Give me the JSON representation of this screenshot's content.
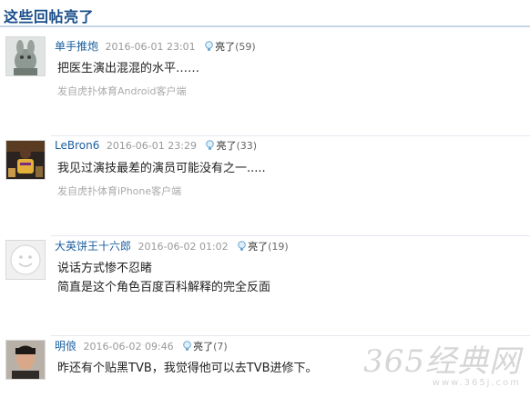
{
  "section_title": "这些回帖亮了",
  "light_label": "亮了",
  "posts": [
    {
      "username": "单手推炮",
      "time": "2016-06-01 23:01",
      "light_count": "(59)",
      "content": [
        "把医生演出混混的水平……"
      ],
      "source": "发自虎扑体育Android客户端",
      "avatar": "gray-creature-avatar"
    },
    {
      "username": "LeBron6",
      "time": "2016-06-01 23:29",
      "light_count": "(33)",
      "content": [
        "我见过演技最差的演员可能没有之一....."
      ],
      "source": "发自虎扑体育iPhone客户端",
      "avatar": "basketball-player-avatar"
    },
    {
      "username": "大英饼王十六郎",
      "time": "2016-06-02 01:02",
      "light_count": "(19)",
      "content": [
        "说话方式惨不忍睹",
        "简直是这个角色百度百科解释的完全反面"
      ],
      "source": "",
      "avatar": "default-avatar"
    },
    {
      "username": "明俍",
      "time": "2016-06-02 09:46",
      "light_count": "(7)",
      "content": [
        "昨还有个贴黑TVB，我觉得他可以去TVB进修下。"
      ],
      "source": "",
      "avatar": "man-photo-avatar"
    }
  ],
  "watermark": {
    "brand": "365经典网",
    "url": "www.365j.com"
  }
}
